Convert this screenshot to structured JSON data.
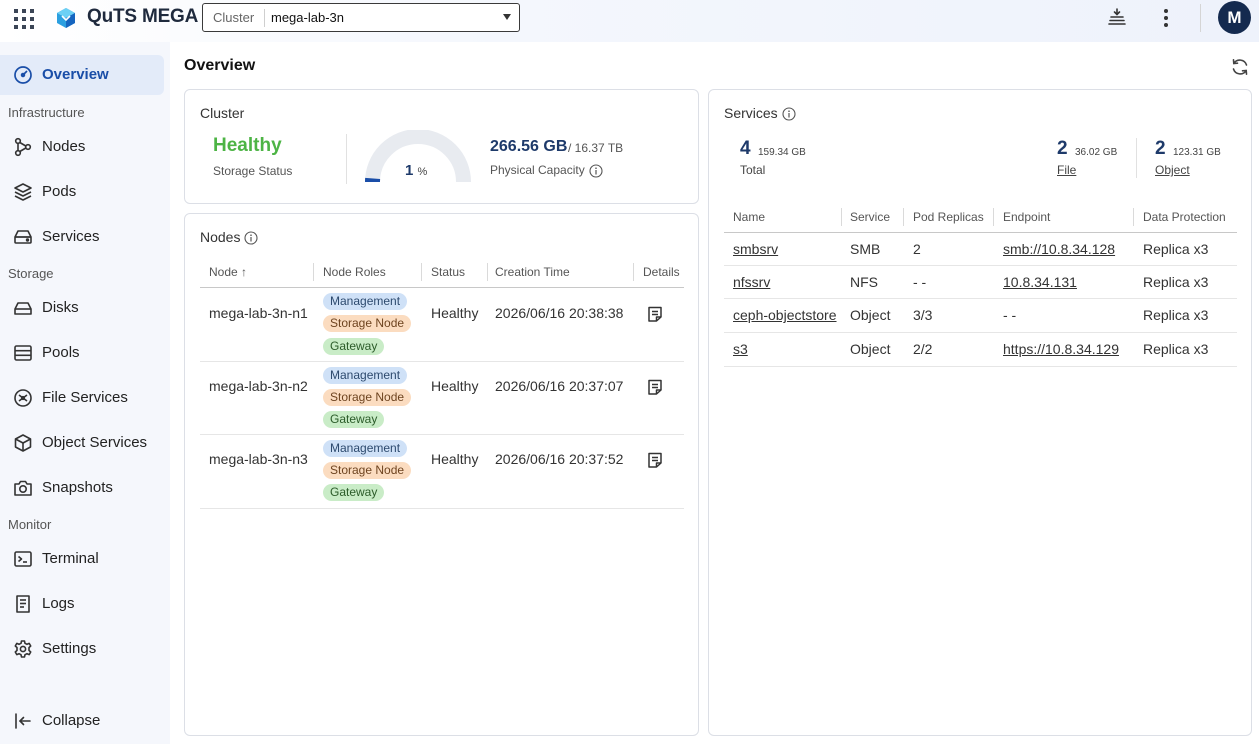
{
  "app": {
    "brand": "QuTS MEGA"
  },
  "cluster_selector": {
    "label": "Cluster",
    "value": "mega-lab-3n"
  },
  "user": {
    "initial": "M"
  },
  "sidebar": {
    "overview": "Overview",
    "section_infrastructure": "Infrastructure",
    "nodes": "Nodes",
    "pods": "Pods",
    "services": "Services",
    "section_storage": "Storage",
    "disks": "Disks",
    "pools": "Pools",
    "file_services": "File Services",
    "object_services": "Object Services",
    "snapshots": "Snapshots",
    "section_monitor": "Monitor",
    "terminal": "Terminal",
    "logs": "Logs",
    "settings": "Settings",
    "collapse": "Collapse"
  },
  "main": {
    "title": "Overview"
  },
  "cluster_card": {
    "title": "Cluster",
    "status": "Healthy",
    "status_label": "Storage Status",
    "usage_percent": 1,
    "usage_unit": "%",
    "capacity_used": "266.56 GB",
    "capacity_total": "/ 16.37 TB",
    "capacity_label": "Physical Capacity"
  },
  "nodes_card": {
    "title": "Nodes",
    "columns": {
      "node": "Node ↑",
      "roles": "Node Roles",
      "status": "Status",
      "creation": "Creation Time",
      "details": "Details"
    },
    "rows": [
      {
        "node": "mega-lab-3n-n1",
        "roles": [
          "Management",
          "Storage Node",
          "Gateway"
        ],
        "status": "Healthy",
        "creation": "2026/06/16 20:38:38"
      },
      {
        "node": "mega-lab-3n-n2",
        "roles": [
          "Management",
          "Storage Node",
          "Gateway"
        ],
        "status": "Healthy",
        "creation": "2026/06/16 20:37:07"
      },
      {
        "node": "mega-lab-3n-n3",
        "roles": [
          "Management",
          "Storage Node",
          "Gateway"
        ],
        "status": "Healthy",
        "creation": "2026/06/16 20:37:52"
      }
    ]
  },
  "services_card": {
    "title": "Services",
    "total": {
      "count": "4",
      "size": "159.34 GB",
      "label": "Total"
    },
    "file": {
      "count": "2",
      "size": "36.02 GB",
      "label": "File"
    },
    "object": {
      "count": "2",
      "size": "123.31 GB",
      "label": "Object"
    },
    "columns": {
      "name": "Name",
      "service": "Service",
      "replicas": "Pod Replicas",
      "endpoint": "Endpoint",
      "protection": "Data Protection"
    },
    "rows": [
      {
        "name": "smbsrv",
        "service": "SMB",
        "replicas": "2",
        "endpoint": "smb://10.8.34.128",
        "protection": "Replica x3"
      },
      {
        "name": "nfssrv",
        "service": "NFS",
        "replicas": "- -",
        "endpoint": "10.8.34.131",
        "protection": "Replica x3"
      },
      {
        "name": "ceph-objectstore",
        "service": "Object",
        "replicas": "3/3",
        "endpoint": "- -",
        "protection": "Replica x3"
      },
      {
        "name": "s3",
        "service": "Object",
        "replicas": "2/2",
        "endpoint": "https://10.8.34.129",
        "protection": "Replica x3"
      }
    ]
  }
}
